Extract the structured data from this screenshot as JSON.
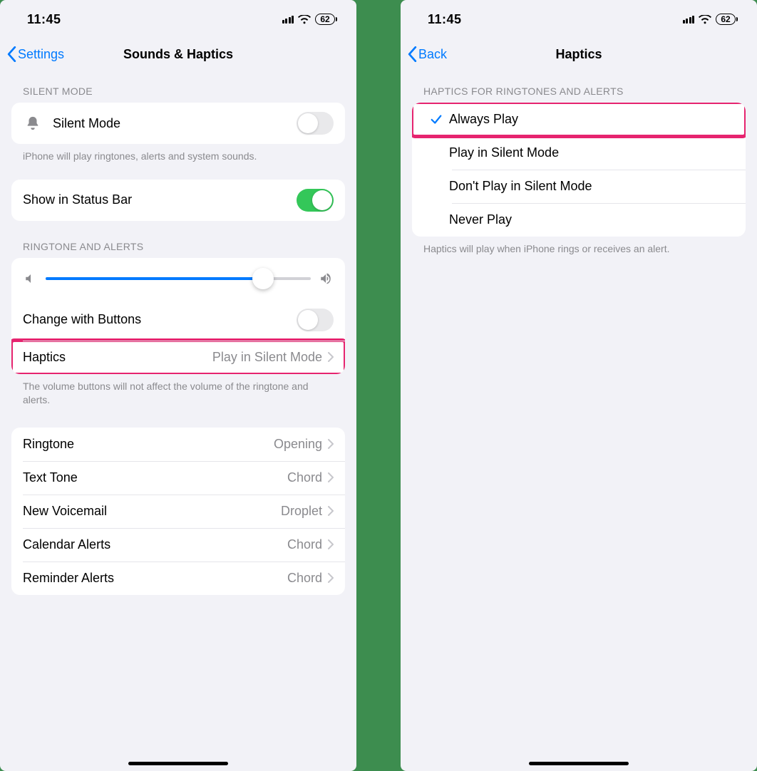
{
  "status": {
    "time": "11:45",
    "battery": "62"
  },
  "left": {
    "back": "Settings",
    "title": "Sounds & Haptics",
    "silent_header": "SILENT MODE",
    "silent_label": "Silent Mode",
    "silent_footer": "iPhone will play ringtones, alerts and system sounds.",
    "statusbar_label": "Show in Status Bar",
    "ringtone_header": "RINGTONE AND ALERTS",
    "slider_percent": 82,
    "change_buttons_label": "Change with Buttons",
    "haptics_label": "Haptics",
    "haptics_value": "Play in Silent Mode",
    "volume_footer": "The volume buttons will not affect the volume of the ringtone and alerts.",
    "sounds": [
      {
        "label": "Ringtone",
        "value": "Opening"
      },
      {
        "label": "Text Tone",
        "value": "Chord"
      },
      {
        "label": "New Voicemail",
        "value": "Droplet"
      },
      {
        "label": "Calendar Alerts",
        "value": "Chord"
      },
      {
        "label": "Reminder Alerts",
        "value": "Chord"
      }
    ]
  },
  "right": {
    "back": "Back",
    "title": "Haptics",
    "header": "HAPTICS FOR RINGTONES AND ALERTS",
    "options": [
      {
        "label": "Always Play",
        "selected": true
      },
      {
        "label": "Play in Silent Mode",
        "selected": false
      },
      {
        "label": "Don't Play in Silent Mode",
        "selected": false
      },
      {
        "label": "Never Play",
        "selected": false
      }
    ],
    "footer": "Haptics will play when iPhone rings or receives an alert."
  }
}
